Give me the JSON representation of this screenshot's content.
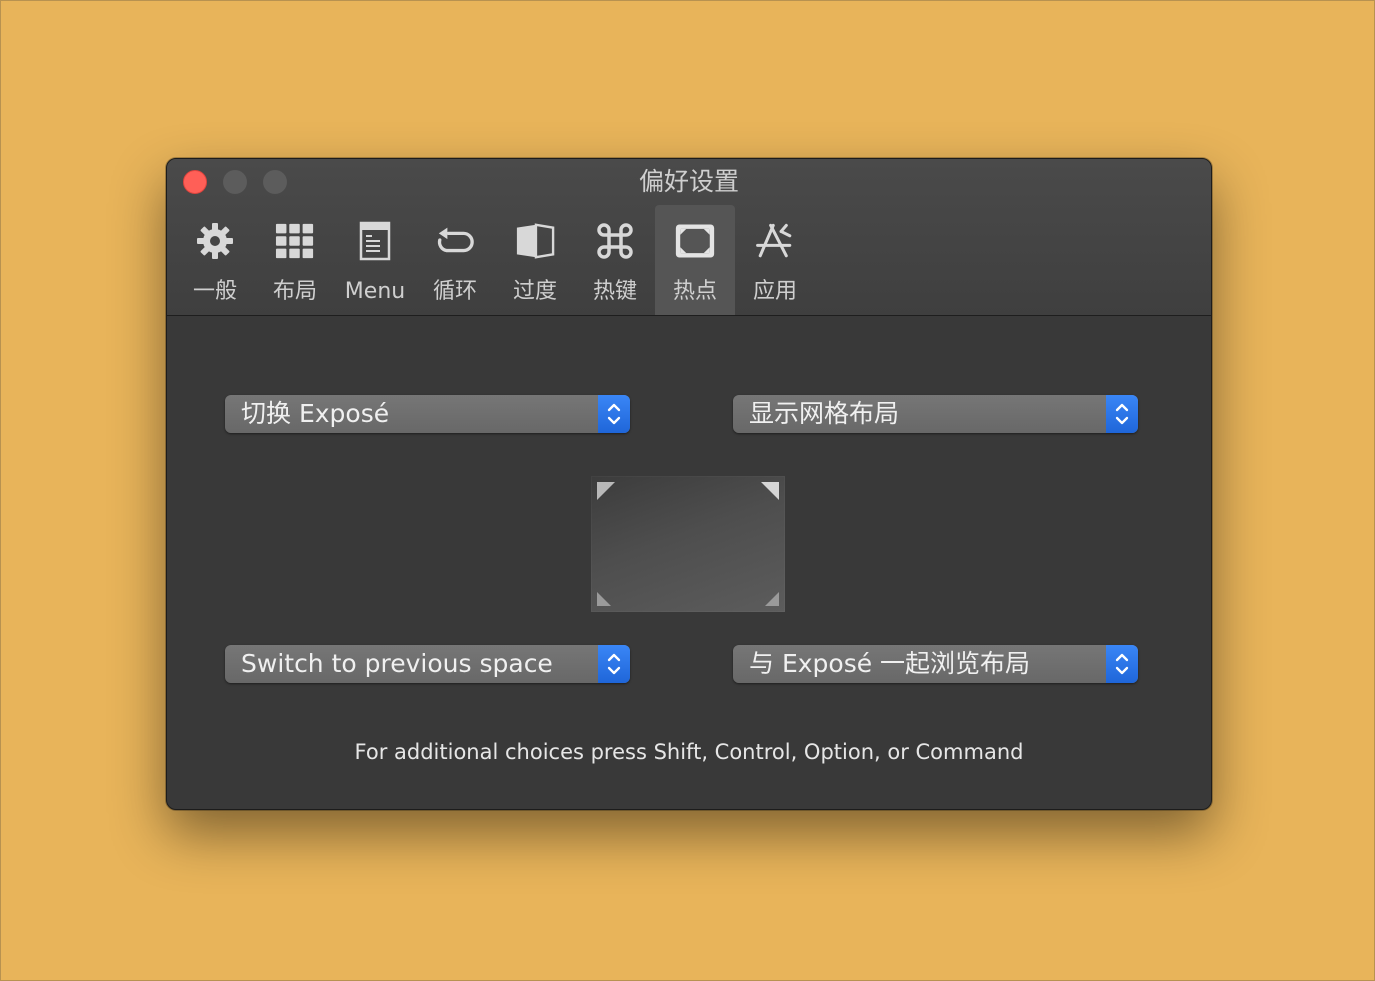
{
  "window": {
    "title": "偏好设置"
  },
  "toolbar": {
    "tabs": [
      {
        "label": "一般",
        "icon": "gear-icon"
      },
      {
        "label": "布局",
        "icon": "grid-icon"
      },
      {
        "label": "Menu",
        "icon": "menu-window-icon"
      },
      {
        "label": "循环",
        "icon": "cycle-icon"
      },
      {
        "label": "过度",
        "icon": "transition-icon"
      },
      {
        "label": "热键",
        "icon": "command-key-icon"
      },
      {
        "label": "热点",
        "icon": "hot-corners-icon",
        "selected": true
      },
      {
        "label": "应用",
        "icon": "app-store-icon"
      }
    ]
  },
  "hot_corners": {
    "top_left": "切换 Exposé",
    "top_right": "显示网格布局",
    "bottom_left": "Switch to previous space",
    "bottom_right": "与 Exposé 一起浏览布局"
  },
  "hint": "For additional choices press Shift, Control, Option, or Command",
  "colors": {
    "background": "#E8B45A",
    "window": "#393939",
    "popup": "#707070",
    "popup_button": "#2A74E8",
    "close_button": "#FF5F57"
  }
}
